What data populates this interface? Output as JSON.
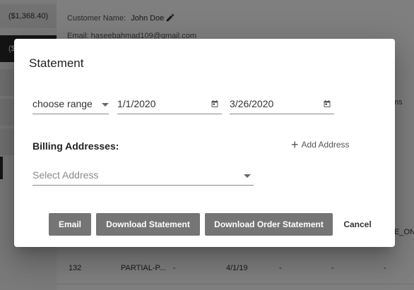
{
  "background": {
    "sidebar_amount": "($1,368.40)",
    "sidebar_dark_label": "($",
    "customer_name_label": "Customer Name:",
    "customer_name_value": "John  Doe",
    "email_line": "Email: haseebahmad109@gmail.com",
    "column_header_partial": "ms",
    "cell_partial": "E_ON_",
    "row": {
      "id": "132",
      "status": "PARTIAL-P...",
      "c3": "-",
      "date": "4/1/19",
      "c5": "-",
      "c6": "-",
      "c7": "-"
    }
  },
  "dialog": {
    "title": "Statement",
    "range_select_value": "choose range",
    "date_from": "1/1/2020",
    "date_to": "3/26/2020",
    "billing_label": "Billing Addresses:",
    "add_address_label": "Add Address",
    "address_placeholder": "Select Address",
    "buttons": {
      "email": "Email",
      "download_statement": "Download Statement",
      "download_order_statement": "Download Order Statement",
      "cancel": "Cancel"
    }
  },
  "icons": {
    "edit": "pencil-icon",
    "calendar": "calendar-icon",
    "dropdown": "chevron-down-icon",
    "add": "plus-icon"
  },
  "colors": {
    "overlay": "rgba(0,0,0,0.5)",
    "button_bg": "#757575",
    "dark_card": "#2b2b2b"
  }
}
